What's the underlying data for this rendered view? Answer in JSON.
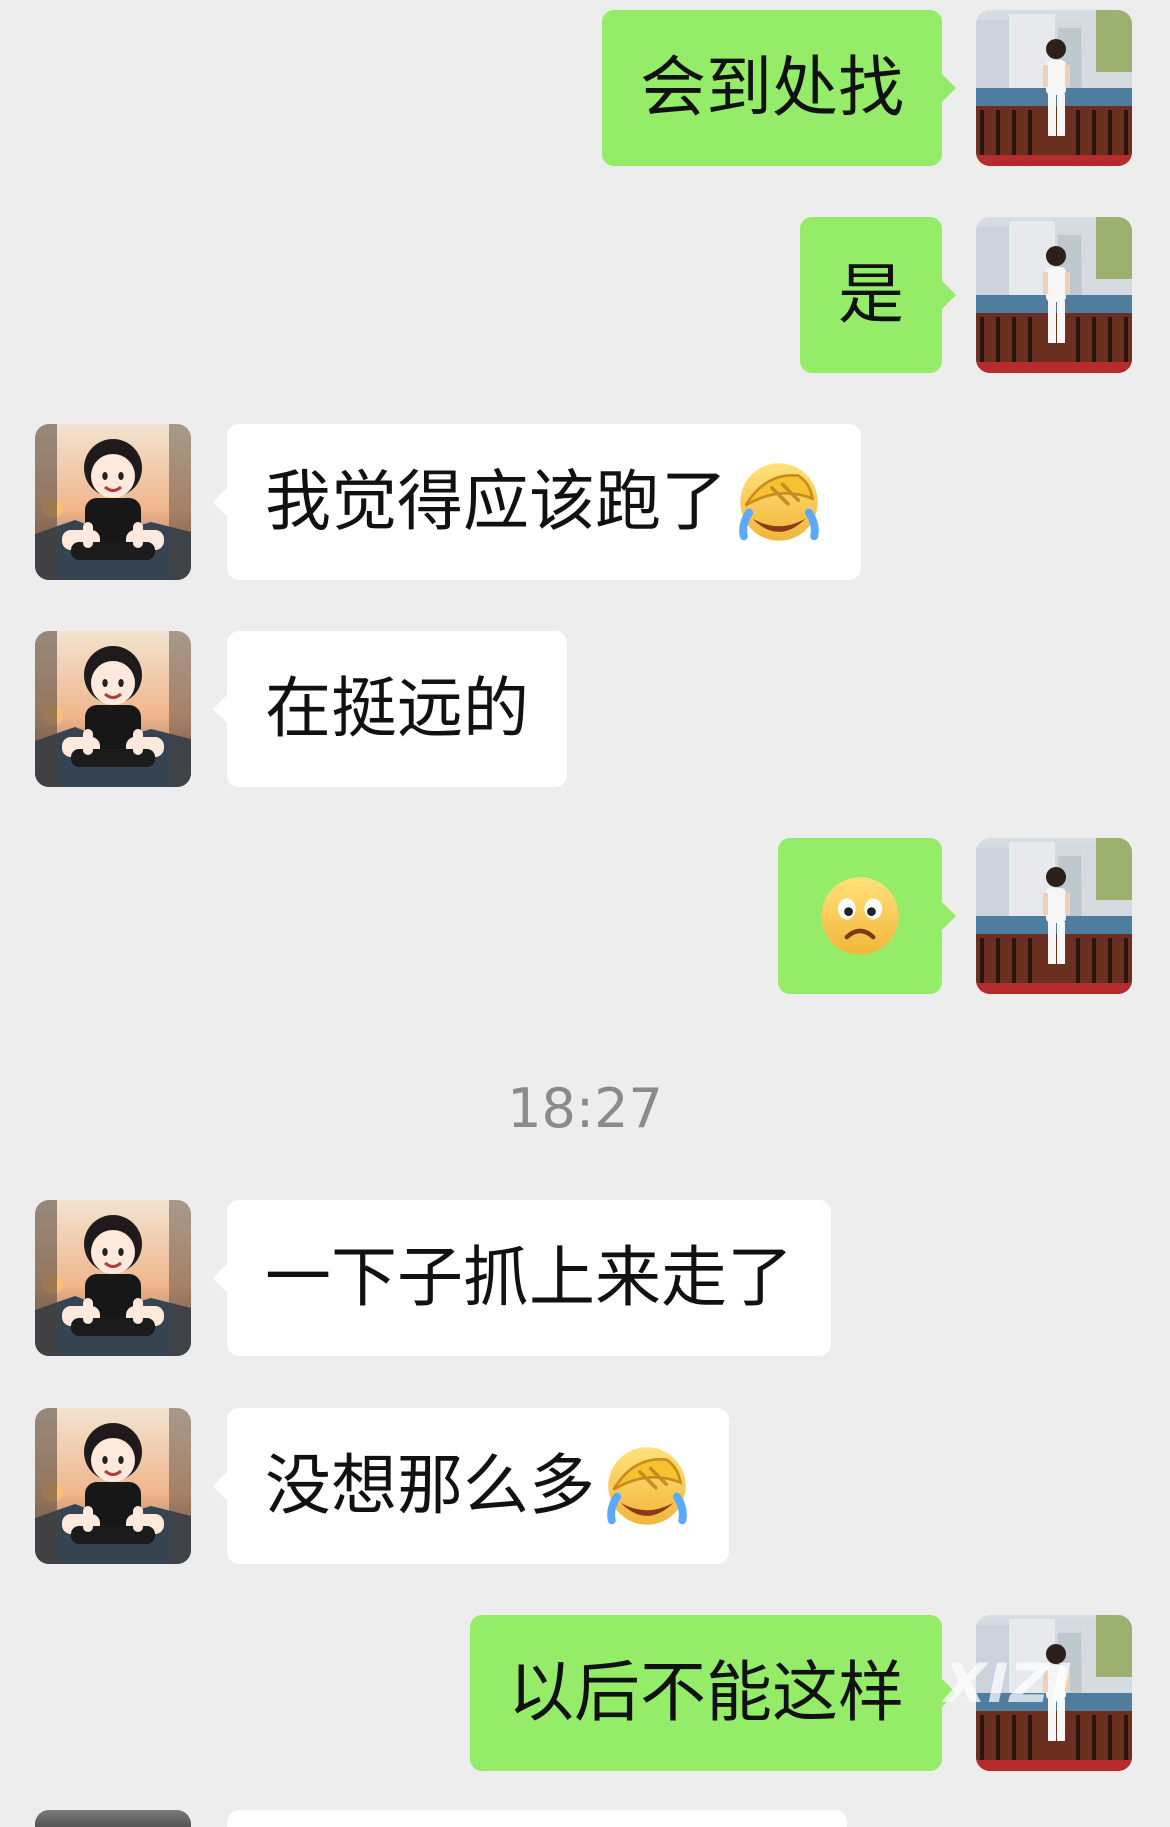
{
  "messages": [
    {
      "text": "会到处找"
    },
    {
      "text": "是"
    },
    {
      "text": "我觉得应该跑了",
      "emoji_name": "facepalm-crying-emoji-icon"
    },
    {
      "text": "在挺远的"
    },
    {
      "emoji_name": "sad-face-emoji-icon"
    },
    {
      "text": "一下子抓上来走了"
    },
    {
      "text": "没想那么多",
      "emoji_name": "facepalm-crying-emoji-icon"
    },
    {
      "text": "以后不能这样"
    }
  ],
  "timestamp": "18:27",
  "watermark": "XIZI",
  "colors": {
    "background": "#ededed",
    "incoming_bubble": "#ffffff",
    "outgoing_bubble": "#95ec69",
    "timestamp": "#8b8b8b"
  }
}
